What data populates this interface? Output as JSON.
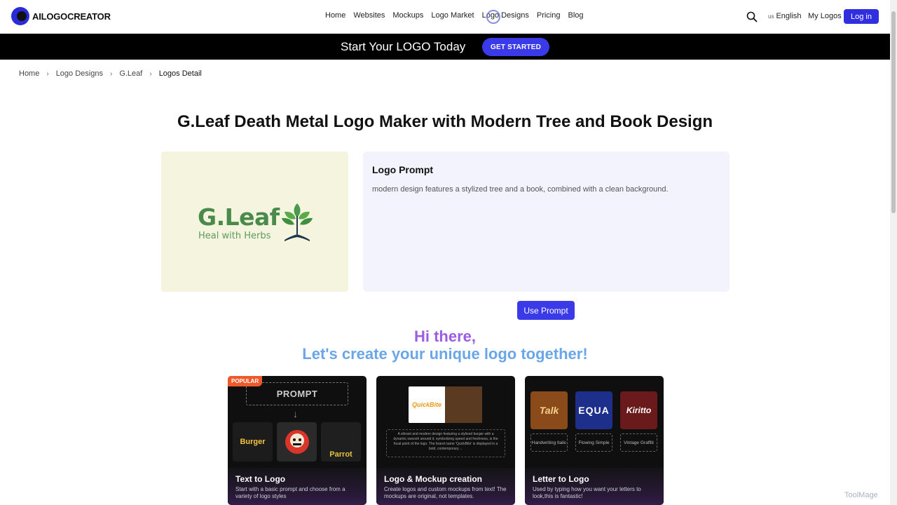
{
  "header": {
    "brand": "AILOGOCREATOR",
    "nav": [
      "Home",
      "Websites",
      "Mockups",
      "Logo Market",
      "Logo Designs",
      "Pricing",
      "Blog"
    ],
    "lang_flag": "us",
    "lang": "English",
    "my_logos": "My Logos",
    "login": "Log in"
  },
  "banner": {
    "text": "Start Your LOGO Today",
    "cta": "GET STARTED"
  },
  "breadcrumb": [
    "Home",
    "Logo Designs",
    "G.Leaf",
    "Logos Detail"
  ],
  "page": {
    "title": "G.Leaf Death Metal Logo Maker with Modern Tree and Book Design"
  },
  "preview": {
    "brand": "G.Leaf",
    "tagline": "Heal with Herbs"
  },
  "prompt": {
    "title": "Logo Prompt",
    "text": "modern design features a stylized tree and a book, combined with a clean background.",
    "button": "Use Prompt"
  },
  "greeting": {
    "line1": "Hi there,",
    "line2": "Let's create your unique logo together!"
  },
  "cards": [
    {
      "badge": "POPULAR",
      "art_label": "PROMPT",
      "tiles": [
        "Burger",
        "",
        "Parrot"
      ],
      "title": "Text to Logo",
      "desc": "Start with a basic prompt and choose from a variety of logo styles"
    },
    {
      "art_brand": "QuickBite",
      "art_text": "A vibrant and modern design featuring a stylized burger with a dynamic swoosh around it, symbolizing speed and freshness, is the focal point of the logo. The brand name 'QuickBite' is displayed in a bold, contemporary ...",
      "title": "Logo & Mockup creation",
      "desc": "Create logos and custom mockups from text! The mockups are original, not templates."
    },
    {
      "tiles": [
        "Talk",
        "EQUA",
        "Kiritto"
      ],
      "labels": [
        "Handwriting Italic",
        "Flowing Simple",
        "Vintage Graffiti"
      ],
      "title": "Letter to Logo",
      "desc": "Used by typing how you want your letters to look,this is fantastic!"
    }
  ],
  "watermark": "ToolMage",
  "colors": {
    "accent": "#3a3ae8",
    "gleaf_green": "#4a8a4a",
    "greeting_purple": "#9b5de5",
    "greeting_blue": "#6aa6e8"
  }
}
